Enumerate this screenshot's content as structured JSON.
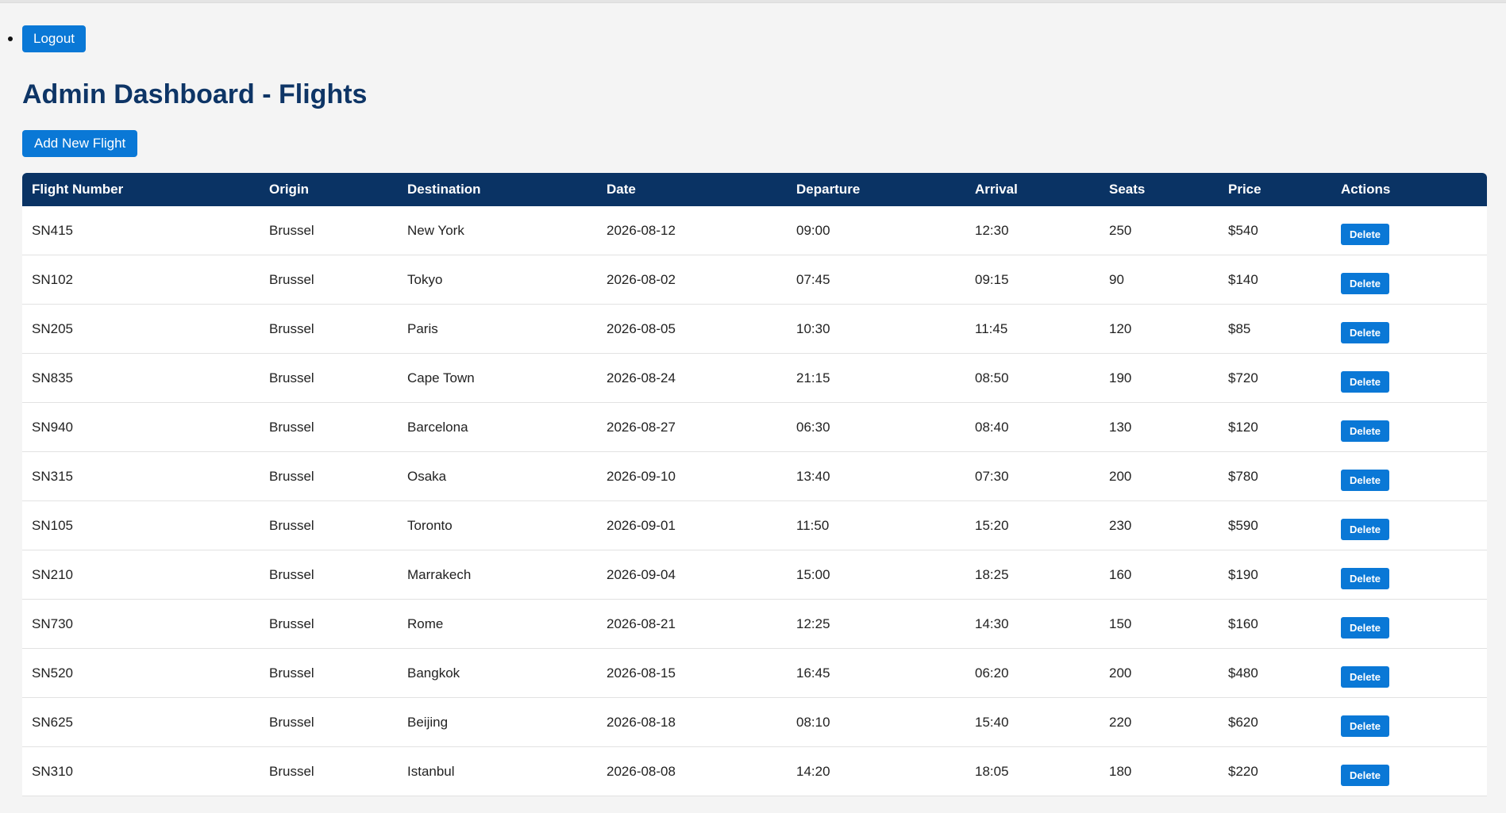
{
  "nav": {
    "logout_label": "Logout"
  },
  "page": {
    "title": "Admin Dashboard - Flights",
    "add_button_label": "Add New Flight"
  },
  "table": {
    "columns": [
      "Flight Number",
      "Origin",
      "Destination",
      "Date",
      "Departure",
      "Arrival",
      "Seats",
      "Price",
      "Actions"
    ],
    "delete_label": "Delete",
    "rows": [
      {
        "flight": "SN415",
        "origin": "Brussel",
        "destination": "New York",
        "date": "2026-08-12",
        "departure": "09:00",
        "arrival": "12:30",
        "seats": "250",
        "price": "$540"
      },
      {
        "flight": "SN102",
        "origin": "Brussel",
        "destination": "Tokyo",
        "date": "2026-08-02",
        "departure": "07:45",
        "arrival": "09:15",
        "seats": "90",
        "price": "$140"
      },
      {
        "flight": "SN205",
        "origin": "Brussel",
        "destination": "Paris",
        "date": "2026-08-05",
        "departure": "10:30",
        "arrival": "11:45",
        "seats": "120",
        "price": "$85"
      },
      {
        "flight": "SN835",
        "origin": "Brussel",
        "destination": "Cape Town",
        "date": "2026-08-24",
        "departure": "21:15",
        "arrival": "08:50",
        "seats": "190",
        "price": "$720"
      },
      {
        "flight": "SN940",
        "origin": "Brussel",
        "destination": "Barcelona",
        "date": "2026-08-27",
        "departure": "06:30",
        "arrival": "08:40",
        "seats": "130",
        "price": "$120"
      },
      {
        "flight": "SN315",
        "origin": "Brussel",
        "destination": "Osaka",
        "date": "2026-09-10",
        "departure": "13:40",
        "arrival": "07:30",
        "seats": "200",
        "price": "$780"
      },
      {
        "flight": "SN105",
        "origin": "Brussel",
        "destination": "Toronto",
        "date": "2026-09-01",
        "departure": "11:50",
        "arrival": "15:20",
        "seats": "230",
        "price": "$590"
      },
      {
        "flight": "SN210",
        "origin": "Brussel",
        "destination": "Marrakech",
        "date": "2026-09-04",
        "departure": "15:00",
        "arrival": "18:25",
        "seats": "160",
        "price": "$190"
      },
      {
        "flight": "SN730",
        "origin": "Brussel",
        "destination": "Rome",
        "date": "2026-08-21",
        "departure": "12:25",
        "arrival": "14:30",
        "seats": "150",
        "price": "$160"
      },
      {
        "flight": "SN520",
        "origin": "Brussel",
        "destination": "Bangkok",
        "date": "2026-08-15",
        "departure": "16:45",
        "arrival": "06:20",
        "seats": "200",
        "price": "$480"
      },
      {
        "flight": "SN625",
        "origin": "Brussel",
        "destination": "Beijing",
        "date": "2026-08-18",
        "departure": "08:10",
        "arrival": "15:40",
        "seats": "220",
        "price": "$620"
      },
      {
        "flight": "SN310",
        "origin": "Brussel",
        "destination": "Istanbul",
        "date": "2026-08-08",
        "departure": "14:20",
        "arrival": "18:05",
        "seats": "180",
        "price": "$220"
      }
    ]
  },
  "colors": {
    "accent": "#0a78d6",
    "header_bg": "#0a3364",
    "title": "#0e3566",
    "page_bg": "#f4f4f4"
  }
}
